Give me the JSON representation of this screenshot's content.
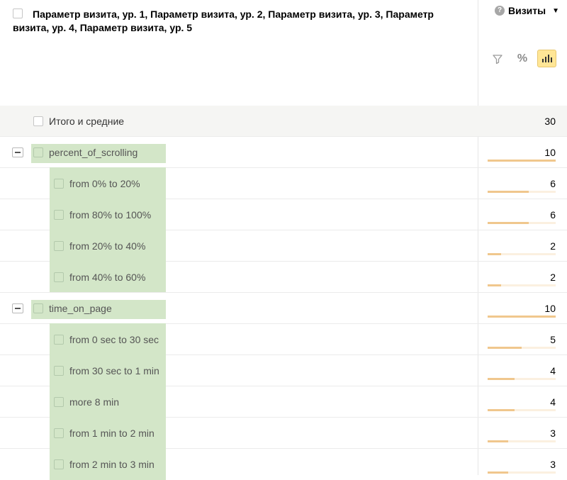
{
  "header": {
    "dimensions_title": "Параметр визита, ур. 1, Параметр визита, ур. 2, Параметр визита, ур. 3, Параметр визита, ур. 4, Параметр визита, ур. 5",
    "metric_label": "Визиты",
    "help_glyph": "?",
    "dropdown_glyph": "▼",
    "percent_glyph": "%",
    "tools": [
      "filter-icon",
      "percent-icon",
      "bar-chart-icon"
    ],
    "active_tool": "bar-chart-icon"
  },
  "total_row": {
    "label": "Итого и средние",
    "value": "30"
  },
  "rows": [
    {
      "type": "group",
      "label": "percent_of_scrolling",
      "value": "10",
      "share": 1.0
    },
    {
      "type": "child",
      "label": "from 0% to 20%",
      "value": "6",
      "share": 0.6
    },
    {
      "type": "child",
      "label": "from 80% to 100%",
      "value": "6",
      "share": 0.6
    },
    {
      "type": "child",
      "label": "from 20% to 40%",
      "value": "2",
      "share": 0.2
    },
    {
      "type": "child",
      "label": "from 40% to 60%",
      "value": "2",
      "share": 0.2
    },
    {
      "type": "group",
      "label": "time_on_page",
      "value": "10",
      "share": 1.0
    },
    {
      "type": "child",
      "label": "from 0 sec to 30 sec",
      "value": "5",
      "share": 0.5
    },
    {
      "type": "child",
      "label": "from 30 sec to 1 min",
      "value": "4",
      "share": 0.4
    },
    {
      "type": "child",
      "label": "more 8 min",
      "value": "4",
      "share": 0.4
    },
    {
      "type": "child",
      "label": "from 1 min to 2 min",
      "value": "3",
      "share": 0.3
    },
    {
      "type": "child",
      "label": "from 2 min to 3 min",
      "value": "3",
      "share": 0.3
    }
  ],
  "colors": {
    "highlight": "#d3e6c8",
    "bar": "#f0c78d",
    "bar_track": "#fbf0e0",
    "active_tool": "#ffe696"
  }
}
